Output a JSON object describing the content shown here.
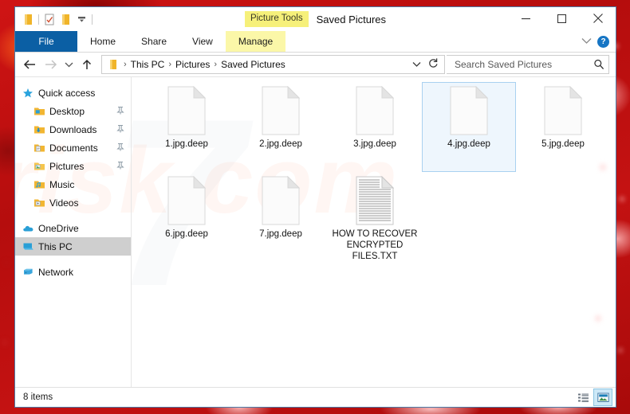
{
  "window": {
    "title": "Saved Pictures",
    "contextual_tab": "Picture Tools",
    "controls": {
      "minimize": "minimize-button",
      "maximize": "maximize-button",
      "close": "close-button"
    },
    "help_label": "?"
  },
  "quick_access_toolbar": {
    "items": [
      {
        "name": "properties-icon",
        "label": ""
      },
      {
        "name": "new-folder-icon",
        "label": ""
      },
      {
        "name": "customize-qat-icon",
        "label": ""
      }
    ]
  },
  "ribbon": {
    "tabs": [
      {
        "id": "file",
        "label": "File"
      },
      {
        "id": "home",
        "label": "Home"
      },
      {
        "id": "share",
        "label": "Share"
      },
      {
        "id": "view",
        "label": "View"
      },
      {
        "id": "manage",
        "label": "Manage"
      }
    ]
  },
  "address_bar": {
    "back_label": "Back",
    "forward_label": "Forward",
    "recent_label": "Recent locations",
    "up_label": "Up",
    "breadcrumbs": [
      "This PC",
      "Pictures",
      "Saved Pictures"
    ],
    "separator": "›",
    "refresh_label": "Refresh"
  },
  "search": {
    "placeholder": "Search Saved Pictures",
    "value": ""
  },
  "navigation_pane": {
    "groups": [
      {
        "header": {
          "label": "Quick access",
          "icon": "star-icon"
        },
        "items": [
          {
            "label": "Desktop",
            "icon": "desktop-folder-icon",
            "pinned": true
          },
          {
            "label": "Downloads",
            "icon": "downloads-folder-icon",
            "pinned": true
          },
          {
            "label": "Documents",
            "icon": "documents-folder-icon",
            "pinned": true
          },
          {
            "label": "Pictures",
            "icon": "pictures-folder-icon",
            "pinned": true
          },
          {
            "label": "Music",
            "icon": "music-folder-icon",
            "pinned": false
          },
          {
            "label": "Videos",
            "icon": "videos-folder-icon",
            "pinned": false
          }
        ]
      }
    ],
    "roots": [
      {
        "label": "OneDrive",
        "icon": "onedrive-icon",
        "selected": false
      },
      {
        "label": "This PC",
        "icon": "this-pc-icon",
        "selected": true
      },
      {
        "label": "Network",
        "icon": "network-icon",
        "selected": false
      }
    ]
  },
  "files": [
    {
      "name": "1.jpg.deep",
      "type": "blank-document",
      "selected": false
    },
    {
      "name": "2.jpg.deep",
      "type": "blank-document",
      "selected": false
    },
    {
      "name": "3.jpg.deep",
      "type": "blank-document",
      "selected": false
    },
    {
      "name": "4.jpg.deep",
      "type": "blank-document",
      "selected": true
    },
    {
      "name": "5.jpg.deep",
      "type": "blank-document",
      "selected": false
    },
    {
      "name": "6.jpg.deep",
      "type": "blank-document",
      "selected": false
    },
    {
      "name": "7.jpg.deep",
      "type": "blank-document",
      "selected": false
    },
    {
      "name": "HOW TO RECOVER ENCRYPTED FILES.TXT",
      "type": "text-document",
      "selected": false
    }
  ],
  "status_bar": {
    "item_count": "8 items",
    "views": [
      {
        "name": "details-view-button",
        "active": false
      },
      {
        "name": "large-icons-view-button",
        "active": true
      }
    ]
  },
  "watermark": {
    "text": "risk.com",
    "mark": "7"
  },
  "colors": {
    "file_tab": "#0b5fa4",
    "contextual_tab": "#fbf7a8",
    "selection": "#a9d1f0",
    "nav_selected": "#cfcfcf",
    "desktop": "#c41212",
    "help_blue": "#1675c4"
  }
}
